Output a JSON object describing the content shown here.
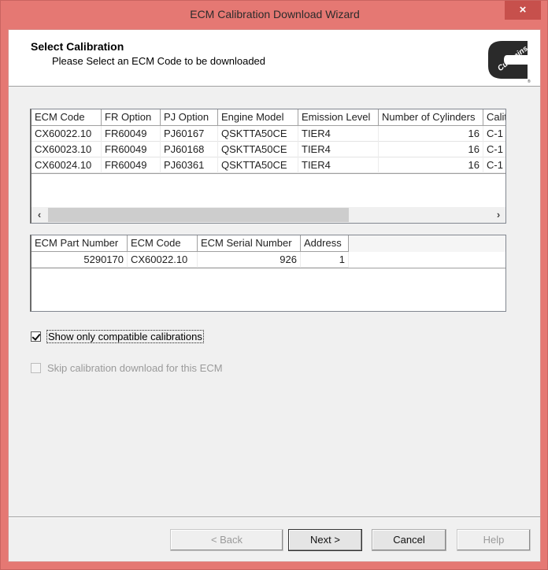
{
  "window": {
    "title": "ECM Calibration Download Wizard",
    "close_icon": "×"
  },
  "header": {
    "title": "Select Calibration",
    "subtitle": "Please Select an ECM Code to be downloaded",
    "logo_text": "Cummins"
  },
  "calibrations_table": {
    "columns": [
      "ECM Code",
      "FR Option",
      "PJ Option",
      "Engine Model",
      "Emission Level",
      "Number of Cylinders",
      "Calit"
    ],
    "rows": [
      [
        "CX60022.10",
        "FR60049",
        "PJ60167",
        "QSKTTA50CE",
        "TIER4",
        "16",
        "C-1"
      ],
      [
        "CX60023.10",
        "FR60049",
        "PJ60168",
        "QSKTTA50CE",
        "TIER4",
        "16",
        "C-1"
      ],
      [
        "CX60024.10",
        "FR60049",
        "PJ60361",
        "QSKTTA50CE",
        "TIER4",
        "16",
        "C-1"
      ]
    ],
    "scroll_left": "‹",
    "scroll_right": "›"
  },
  "ecm_table": {
    "columns": [
      "ECM Part Number",
      "ECM Code",
      "ECM Serial Number",
      "Address"
    ],
    "rows": [
      [
        "5290170",
        "CX60022.10",
        "926",
        "1"
      ]
    ]
  },
  "options": {
    "show_compatible": {
      "label": "Show only compatible calibrations",
      "checked": true
    },
    "skip_download": {
      "label": "Skip calibration download for this ECM",
      "checked": false,
      "disabled": true
    }
  },
  "buttons": {
    "back": "< Back",
    "next": "Next >",
    "cancel": "Cancel",
    "help": "Help"
  }
}
